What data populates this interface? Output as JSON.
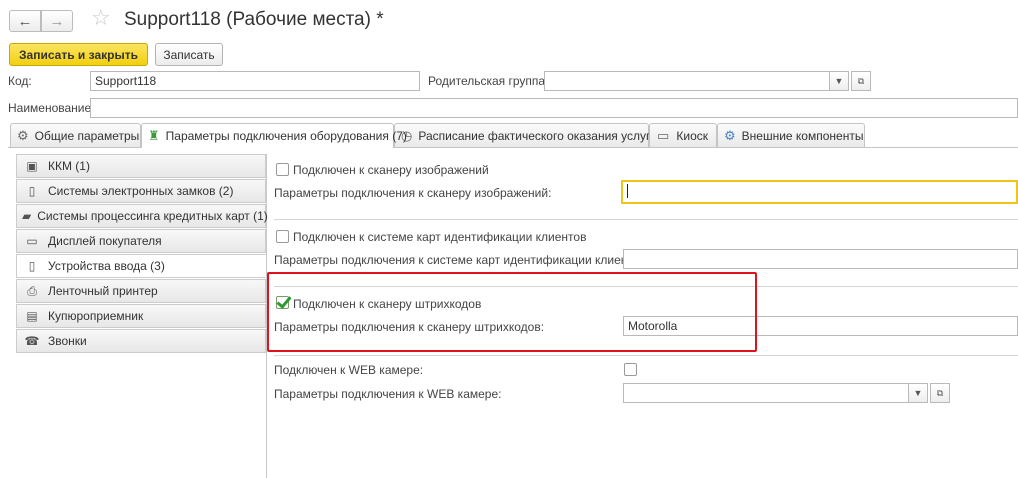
{
  "window": {
    "title": "Support118 (Рабочие места) *",
    "back_symbol": "←",
    "forward_symbol": "→",
    "star_symbol": "☆"
  },
  "toolbar": {
    "save_close_label": "Записать и закрыть",
    "save_label": "Записать"
  },
  "form": {
    "code_label": "Код:",
    "code_value": "Support118",
    "parent_label": "Родительская группа:",
    "parent_value": "",
    "name_label": "Наименование:",
    "name_value": ""
  },
  "tabs": [
    {
      "label": "Общие параметры",
      "icon": "gear-icon"
    },
    {
      "label": "Параметры подключения оборудования (7)",
      "icon": "cashier-icon",
      "active": true
    },
    {
      "label": "Расписание фактического оказания услуг",
      "icon": "clock-icon"
    },
    {
      "label": "Киоск",
      "icon": "kiosk-icon"
    },
    {
      "label": "Внешние компоненты",
      "icon": "component-icon"
    }
  ],
  "equipment_list": [
    {
      "label": "ККМ (1)",
      "icon": "cash-register-icon"
    },
    {
      "label": "Системы электронных замков (2)",
      "icon": "lock-card-icon"
    },
    {
      "label": "Системы процессинга кредитных карт (1)",
      "icon": "credit-card-icon"
    },
    {
      "label": "Дисплей покупателя",
      "icon": "monitor-icon"
    },
    {
      "label": "Устройства ввода (3)",
      "icon": "input-device-icon",
      "active": true
    },
    {
      "label": "Ленточный принтер",
      "icon": "printer-icon"
    },
    {
      "label": "Купюроприемник",
      "icon": "bill-acceptor-icon"
    },
    {
      "label": "Звонки",
      "icon": "phone-icon"
    }
  ],
  "devices": {
    "scanner_images": {
      "checkbox_label": "Подключен к сканеру изображений",
      "checked": false,
      "params_label": "Параметры подключения к сканеру изображений:",
      "params_value": ""
    },
    "client_cards": {
      "checkbox_label": "Подключен к системе карт идентификации клиентов",
      "checked": false,
      "params_label": "Параметры подключения к системе карт идентификации клиентов:",
      "params_value": ""
    },
    "barcode_scanner": {
      "checkbox_label": "Подключен к сканеру штрихкодов",
      "checked": true,
      "params_label": "Параметры подключения к сканеру штрихкодов:",
      "params_value": "Motorolla"
    },
    "web_camera": {
      "checkbox_label": "Подключен к WEB камере:",
      "checked": false,
      "params_label": "Параметры подключения к WEB камере:",
      "params_value": ""
    }
  },
  "colors": {
    "primary_button": "#f2cf0f",
    "highlight_border": "#e0121b",
    "focused_field_border": "#f0c419",
    "check_mark": "#2e9a33"
  }
}
